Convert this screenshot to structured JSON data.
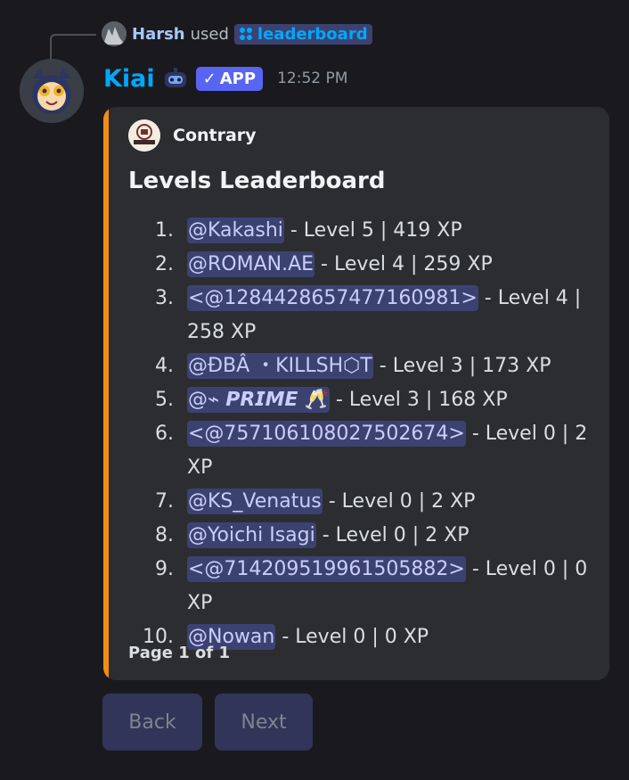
{
  "interaction": {
    "user": "Harsh",
    "used_text": "used",
    "command": "leaderboard"
  },
  "message": {
    "author": "Kiai",
    "app_badge": "APP",
    "timestamp": "12:52 PM"
  },
  "embed": {
    "accent_color": "#f28c16",
    "author_name": "Contrary",
    "author_icon_text": "CONTRARY",
    "title": "Levels Leaderboard",
    "entries": [
      {
        "rank": "1.",
        "name": "@Kakashi",
        "stats": " - Level 5 | 419 XP"
      },
      {
        "rank": "2.",
        "name": "@ROMAN.AE",
        "stats": " - Level 4 | 259 XP"
      },
      {
        "rank": "3.",
        "name": "<@1284428657477160981>",
        "stats": " - Level 4 | 258 XP"
      },
      {
        "rank": "4.",
        "name": "@ĐBÂ ・KILLSH⬡T",
        "stats": " - Level 3 | 173 XP"
      },
      {
        "rank": "5.",
        "name": "@⌁ 𝙋𝙍𝙄𝙈𝙀 🥂",
        "stats": " - Level 3 | 168 XP"
      },
      {
        "rank": "6.",
        "name": "<@757106108027502674>",
        "stats": " - Level 0 | 2 XP"
      },
      {
        "rank": "7.",
        "name": "@KS_Venatus",
        "stats": " - Level 0 | 2 XP"
      },
      {
        "rank": "8.",
        "name": "@Yoichi Isagi",
        "stats": " - Level 0 | 2 XP"
      },
      {
        "rank": "9.",
        "name": "<@714209519961505882>",
        "stats": " - Level 0 | 0 XP"
      },
      {
        "rank": "10.",
        "name": "@Nowan",
        "stats": " - Level 0 | 0 XP"
      }
    ],
    "footer": "Page 1 of 1"
  },
  "buttons": {
    "back": "Back",
    "next": "Next"
  }
}
